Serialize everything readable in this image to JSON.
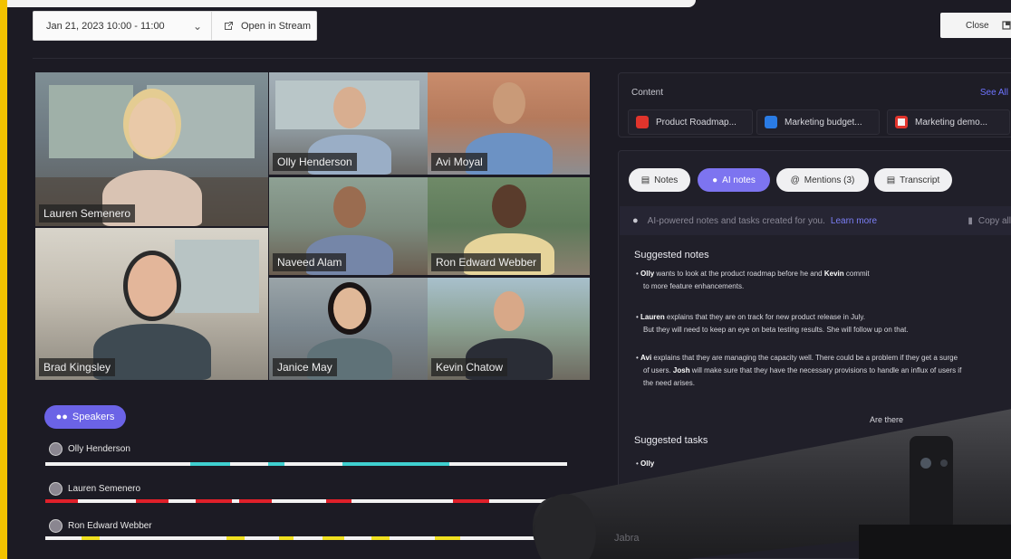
{
  "header": {
    "date_range": "Jan 21, 2023 10:00 - 11:00",
    "open_stream_label": "Open in Stream",
    "close_label": "Close"
  },
  "participants": [
    {
      "name": "Lauren Semenero"
    },
    {
      "name": "Olly Henderson"
    },
    {
      "name": "Avi Moyal"
    },
    {
      "name": "Naveed Alam"
    },
    {
      "name": "Ron Edward Webber"
    },
    {
      "name": "Brad Kingsley"
    },
    {
      "name": "Janice May"
    },
    {
      "name": "Kevin Chatow"
    }
  ],
  "speakers": {
    "button_label": "Speakers",
    "rows": [
      {
        "name": "Olly Henderson",
        "color": "#3fd0d0"
      },
      {
        "name": "Lauren Semenero",
        "color": "#e0202a"
      },
      {
        "name": "Ron Edward Webber",
        "color": "#f0e020"
      }
    ]
  },
  "content": {
    "label": "Content",
    "see_all": "See All",
    "files": [
      {
        "name": "Product Roadmap...",
        "icon": "pdf-icon",
        "color": "#e0342c"
      },
      {
        "name": "Marketing budget...",
        "icon": "word-icon",
        "color": "#2a7be4"
      },
      {
        "name": "Marketing demo...",
        "icon": "video-icon",
        "color": "#e0342c"
      }
    ]
  },
  "tabs": [
    {
      "label": "Notes"
    },
    {
      "label": "AI notes"
    },
    {
      "label": "Mentions (3)"
    },
    {
      "label": "Transcript"
    }
  ],
  "ai_bar": {
    "text": "AI-powered notes and tasks created for you.",
    "learn_more": "Learn more",
    "copy_all": "Copy all"
  },
  "suggested_notes": {
    "title": "Suggested notes",
    "items": [
      {
        "p1": "Olly",
        "t1": " wants to look at the product roadmap before he and ",
        "p2": "Kevin",
        "t2": " commit",
        "line2": "to more feature enhancements."
      },
      {
        "p1": "Lauren",
        "t1": " explains that they are on track for new product release in July.",
        "p2": "",
        "t2": "",
        "line2": "But they will need to keep an eye on beta testing results. She will follow up on that."
      },
      {
        "p1": "Avi",
        "t1": " explains that they are managing the capacity well. There could be a problem if they get a surge",
        "p2": "",
        "t2": "",
        "line2": "of users. ",
        "p3": "Josh",
        "line2b": " will make sure that they have the necessary provisions to handle an influx of users if",
        "line3": "the need arises."
      }
    ],
    "trailing": "Are there"
  },
  "suggested_tasks": {
    "title": "Suggested tasks",
    "first": "Olly"
  },
  "device": {
    "brand": "Jabra"
  }
}
